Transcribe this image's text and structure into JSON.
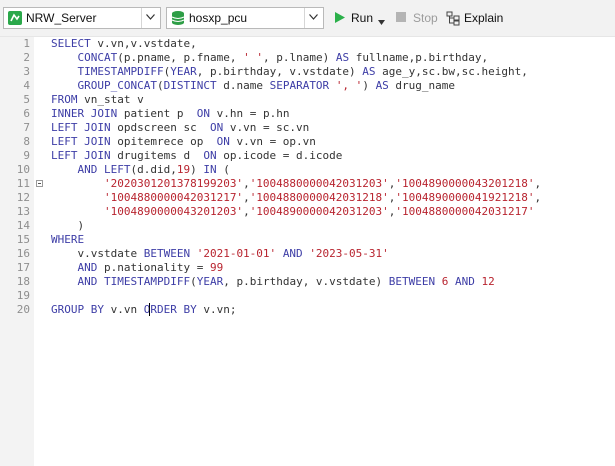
{
  "toolbar": {
    "connection": "NRW_Server",
    "database": "hosxp_pcu",
    "run_label": "Run",
    "stop_label": "Stop",
    "explain_label": "Explain"
  },
  "editor": {
    "lines": [
      {
        "n": "1",
        "tokens": [
          {
            "t": "SELECT ",
            "c": "kw"
          },
          {
            "t": "v.vn,v.vstdate,",
            "c": "id"
          }
        ]
      },
      {
        "n": "2",
        "tokens": [
          {
            "t": "    ",
            "c": "id"
          },
          {
            "t": "CONCAT",
            "c": "fn"
          },
          {
            "t": "(p.pname, p.fname, ",
            "c": "id"
          },
          {
            "t": "' '",
            "c": "str"
          },
          {
            "t": ", p.lname) ",
            "c": "id"
          },
          {
            "t": "AS",
            "c": "kw"
          },
          {
            "t": " fullname,p.birthday,",
            "c": "id"
          }
        ]
      },
      {
        "n": "3",
        "tokens": [
          {
            "t": "    ",
            "c": "id"
          },
          {
            "t": "TIMESTAMPDIFF",
            "c": "fn"
          },
          {
            "t": "(",
            "c": "id"
          },
          {
            "t": "YEAR",
            "c": "kw"
          },
          {
            "t": ", p.birthday, v.vstdate) ",
            "c": "id"
          },
          {
            "t": "AS",
            "c": "kw"
          },
          {
            "t": " age_y,sc.bw,sc.height,",
            "c": "id"
          }
        ]
      },
      {
        "n": "4",
        "tokens": [
          {
            "t": "    ",
            "c": "id"
          },
          {
            "t": "GROUP_CONCAT",
            "c": "fn"
          },
          {
            "t": "(",
            "c": "id"
          },
          {
            "t": "DISTINCT",
            "c": "kw"
          },
          {
            "t": " d.name ",
            "c": "id"
          },
          {
            "t": "SEPARATOR",
            "c": "kw"
          },
          {
            "t": " ",
            "c": "id"
          },
          {
            "t": "', '",
            "c": "str"
          },
          {
            "t": ") ",
            "c": "id"
          },
          {
            "t": "AS",
            "c": "kw"
          },
          {
            "t": " drug_name",
            "c": "id"
          }
        ]
      },
      {
        "n": "5",
        "tokens": [
          {
            "t": "FROM",
            "c": "kw"
          },
          {
            "t": " vn_stat v",
            "c": "id"
          }
        ]
      },
      {
        "n": "6",
        "tokens": [
          {
            "t": "INNER JOIN",
            "c": "kw"
          },
          {
            "t": " patient p  ",
            "c": "id"
          },
          {
            "t": "ON",
            "c": "kw"
          },
          {
            "t": " v.hn = p.hn",
            "c": "id"
          }
        ]
      },
      {
        "n": "7",
        "tokens": [
          {
            "t": "LEFT JOIN",
            "c": "kw"
          },
          {
            "t": " opdscreen sc  ",
            "c": "id"
          },
          {
            "t": "ON",
            "c": "kw"
          },
          {
            "t": " v.vn = sc.vn",
            "c": "id"
          }
        ]
      },
      {
        "n": "8",
        "tokens": [
          {
            "t": "LEFT JOIN",
            "c": "kw"
          },
          {
            "t": " opitemrece op  ",
            "c": "id"
          },
          {
            "t": "ON",
            "c": "kw"
          },
          {
            "t": " v.vn = op.vn",
            "c": "id"
          }
        ]
      },
      {
        "n": "9",
        "tokens": [
          {
            "t": "LEFT JOIN",
            "c": "kw"
          },
          {
            "t": " drugitems d  ",
            "c": "id"
          },
          {
            "t": "ON",
            "c": "kw"
          },
          {
            "t": " op.icode = d.icode",
            "c": "id"
          }
        ]
      },
      {
        "n": "10",
        "tokens": [
          {
            "t": "    ",
            "c": "id"
          },
          {
            "t": "AND",
            "c": "kw"
          },
          {
            "t": " ",
            "c": "id"
          },
          {
            "t": "LEFT",
            "c": "fn"
          },
          {
            "t": "(d.did,",
            "c": "id"
          },
          {
            "t": "19",
            "c": "num"
          },
          {
            "t": ") ",
            "c": "id"
          },
          {
            "t": "IN",
            "c": "kw"
          },
          {
            "t": " (",
            "c": "id"
          }
        ]
      },
      {
        "n": "11",
        "fold": true,
        "tokens": [
          {
            "t": "        ",
            "c": "id"
          },
          {
            "t": "'202030120137819920З'",
            "c": "str"
          },
          {
            "t": ",",
            "c": "id"
          },
          {
            "t": "'1004880000042031203'",
            "c": "str"
          },
          {
            "t": ",",
            "c": "id"
          },
          {
            "t": "'1004890000043201218'",
            "c": "str"
          },
          {
            "t": ",",
            "c": "id"
          }
        ]
      },
      {
        "n": "12",
        "tokens": [
          {
            "t": "        ",
            "c": "id"
          },
          {
            "t": "'1004880000042031217'",
            "c": "str"
          },
          {
            "t": ",",
            "c": "id"
          },
          {
            "t": "'1004880000042031218'",
            "c": "str"
          },
          {
            "t": ",",
            "c": "id"
          },
          {
            "t": "'1004890000041921218'",
            "c": "str"
          },
          {
            "t": ",",
            "c": "id"
          }
        ]
      },
      {
        "n": "13",
        "tokens": [
          {
            "t": "        ",
            "c": "id"
          },
          {
            "t": "'1004890000043201203'",
            "c": "str"
          },
          {
            "t": ",",
            "c": "id"
          },
          {
            "t": "'1004890000042031203'",
            "c": "str"
          },
          {
            "t": ",",
            "c": "id"
          },
          {
            "t": "'1004880000042031217'",
            "c": "str"
          }
        ]
      },
      {
        "n": "14",
        "tokens": [
          {
            "t": "    )",
            "c": "id"
          }
        ]
      },
      {
        "n": "15",
        "tokens": [
          {
            "t": "WHERE",
            "c": "kw"
          }
        ]
      },
      {
        "n": "16",
        "tokens": [
          {
            "t": "    v.vstdate ",
            "c": "id"
          },
          {
            "t": "BETWEEN",
            "c": "kw"
          },
          {
            "t": " ",
            "c": "id"
          },
          {
            "t": "'2021-01-01'",
            "c": "str"
          },
          {
            "t": " ",
            "c": "id"
          },
          {
            "t": "AND",
            "c": "kw"
          },
          {
            "t": " ",
            "c": "id"
          },
          {
            "t": "'2023-05-31'",
            "c": "str"
          }
        ]
      },
      {
        "n": "17",
        "tokens": [
          {
            "t": "    ",
            "c": "id"
          },
          {
            "t": "AND",
            "c": "kw"
          },
          {
            "t": " p.nationality = ",
            "c": "id"
          },
          {
            "t": "99",
            "c": "num"
          }
        ]
      },
      {
        "n": "18",
        "tokens": [
          {
            "t": "    ",
            "c": "id"
          },
          {
            "t": "AND",
            "c": "kw"
          },
          {
            "t": " ",
            "c": "id"
          },
          {
            "t": "TIMESTAMPDIFF",
            "c": "fn"
          },
          {
            "t": "(",
            "c": "id"
          },
          {
            "t": "YEAR",
            "c": "kw"
          },
          {
            "t": ", p.birthday, v.vstdate) ",
            "c": "id"
          },
          {
            "t": "BETWEEN",
            "c": "kw"
          },
          {
            "t": " ",
            "c": "id"
          },
          {
            "t": "6",
            "c": "num"
          },
          {
            "t": " ",
            "c": "id"
          },
          {
            "t": "AND",
            "c": "kw"
          },
          {
            "t": " ",
            "c": "id"
          },
          {
            "t": "12",
            "c": "num"
          }
        ]
      },
      {
        "n": "19",
        "tokens": []
      },
      {
        "n": "20",
        "tokens": [
          {
            "t": "GROUP BY",
            "c": "kw"
          },
          {
            "t": " v.vn ",
            "c": "id"
          },
          {
            "t": "ORDER BY",
            "c": "kw"
          },
          {
            "t": " v.vn;",
            "c": "id"
          }
        ]
      }
    ]
  }
}
